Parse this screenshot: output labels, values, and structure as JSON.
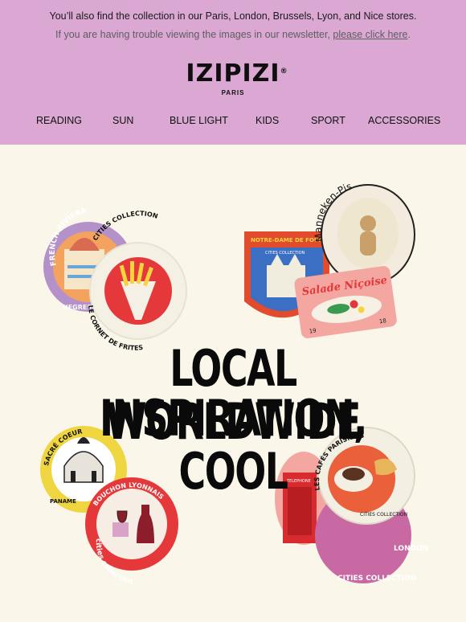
{
  "header": {
    "stores_text": "You’ll also find the collection in our Paris, London, Brussels, Lyon, and Nice stores.",
    "newsletter_text": "If you are having trouble viewing the images in our newsletter, ",
    "newsletter_link": "please click here",
    "newsletter_end": ".",
    "logo_text": "IZIPIZI",
    "logo_reg": "®",
    "logo_city": "PARIS"
  },
  "nav": {
    "items": [
      "READING",
      "SUN",
      "BLUE LIGHT",
      "KIDS",
      "SPORT",
      "ACCESSORIES"
    ]
  },
  "hero": {
    "headline_line1": "LOCAL INSPIRATION,",
    "headline_line2": "WORLDWIDE COOL",
    "stickers": {
      "riviera": "FRENCH RIVIERA",
      "riviera_sub": "NEGRESCO",
      "cornet_title": "CITIES COLLECTION",
      "cornet_sub": "LE CORNET DE FRITES",
      "notre_dame": "NOTRE-DAME DE FOURVIERE",
      "notre_dame_sub": "CITIES COLLECTION",
      "manneken": "Manneken-Pis",
      "salade": "Salade Niçoise",
      "salade_num1": "19",
      "salade_num2": "18",
      "sacre": "SACRÉ COEUR",
      "sacre_sub": "PANAME",
      "bouchon": "BOUCHON LYONNAIS",
      "bouchon_sub": "cities collection",
      "cafes": "LES CAFÉS PARISIENS",
      "cafes_sub": "CITIES COLLECTION",
      "london": "TELEPHONE",
      "london_sub": "CITIES COLLECTION",
      "london_tag": "LONDON"
    }
  },
  "colors": {
    "header_bg": "#dba8d3",
    "hero_bg": "#faf7ea",
    "accent_red": "#e5383b",
    "accent_yellow": "#efd640"
  }
}
